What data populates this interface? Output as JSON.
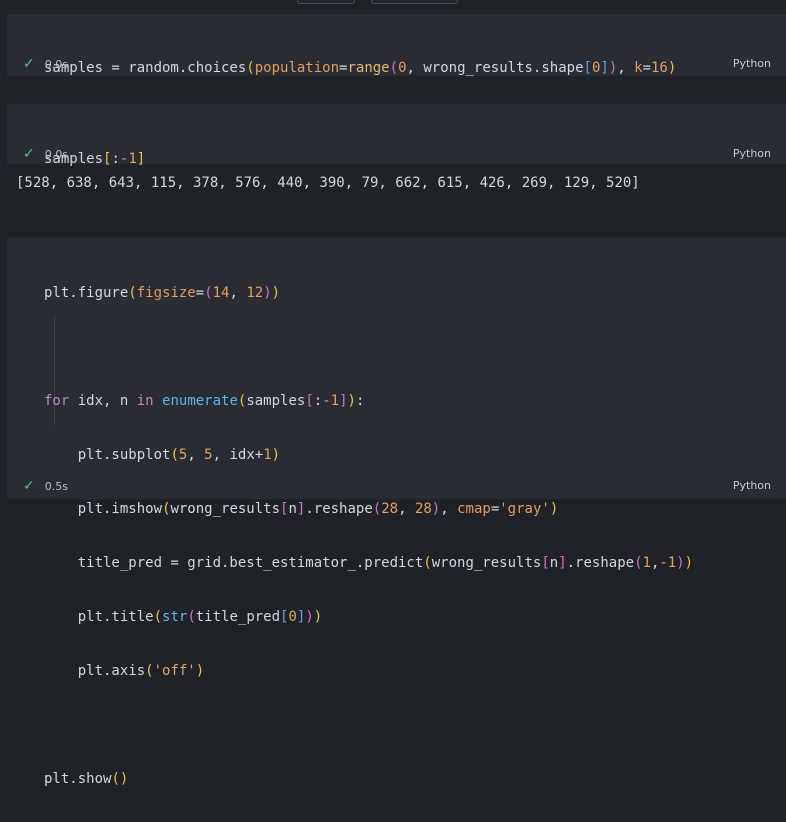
{
  "cells": [
    {
      "status_time": "0.0s",
      "language": "Python"
    },
    {
      "status_time": "0.0s",
      "language": "Python",
      "output": "[528, 638, 643, 115, 378, 576, 440, 390, 79, 662, 615, 426, 269, 129, 520]"
    },
    {
      "status_time": "0.5s",
      "language": "Python"
    }
  ],
  "icons": {
    "success": "check-icon"
  }
}
